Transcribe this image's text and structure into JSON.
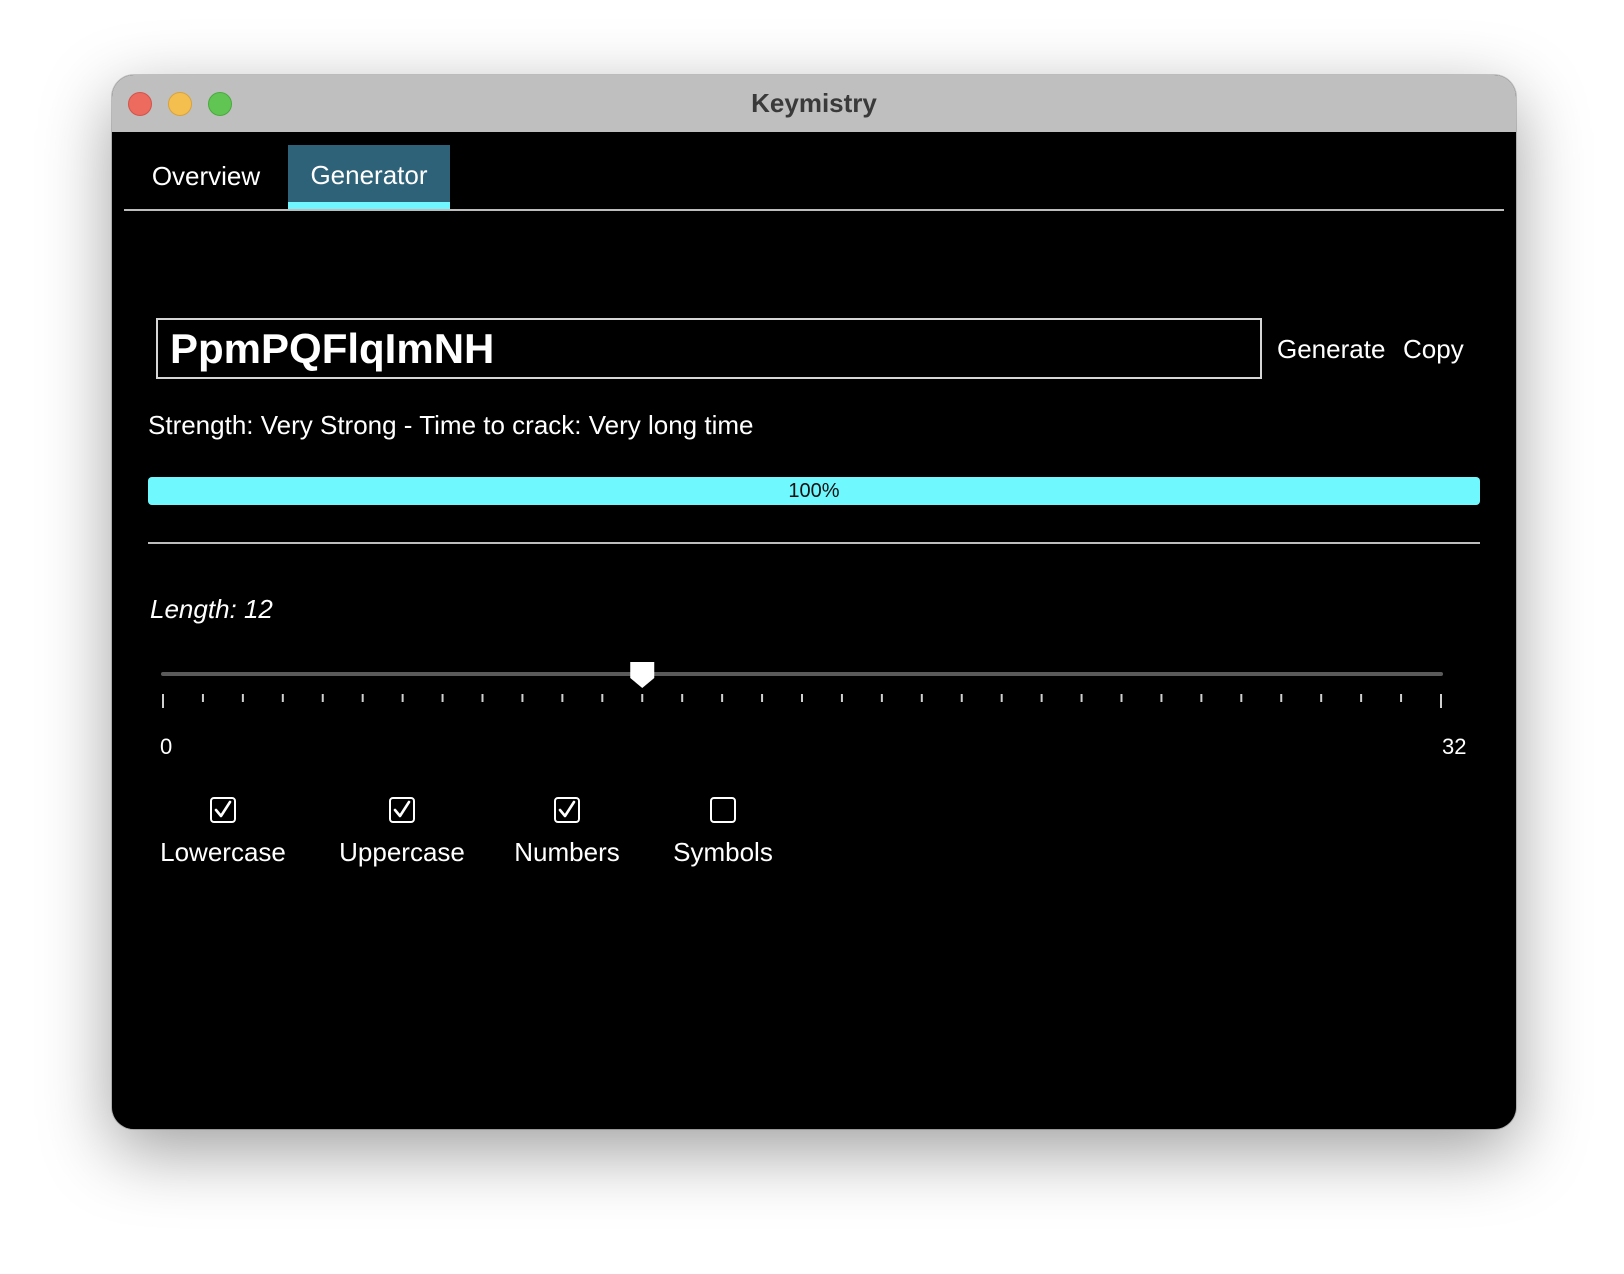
{
  "window": {
    "title": "Keymistry"
  },
  "tabs": [
    {
      "label": "Overview",
      "active": false
    },
    {
      "label": "Generator",
      "active": true
    }
  ],
  "generator": {
    "password": "PpmPQFlqImNH",
    "generate_label": "Generate",
    "copy_label": "Copy",
    "strength_text": "Strength: Very Strong - Time to crack: Very long time",
    "strength_percent": 100,
    "strength_percent_label": "100%",
    "length_label": "Length: 12",
    "length": {
      "value": 12,
      "min": 0,
      "max": 32,
      "min_label": "0",
      "max_label": "32"
    },
    "options": [
      {
        "label": "Lowercase",
        "checked": true
      },
      {
        "label": "Uppercase",
        "checked": true
      },
      {
        "label": "Numbers",
        "checked": true
      },
      {
        "label": "Symbols",
        "checked": false
      }
    ]
  },
  "colors": {
    "accent": "#6ff9ff",
    "active_tab": "#2e6279",
    "background": "#000000"
  }
}
